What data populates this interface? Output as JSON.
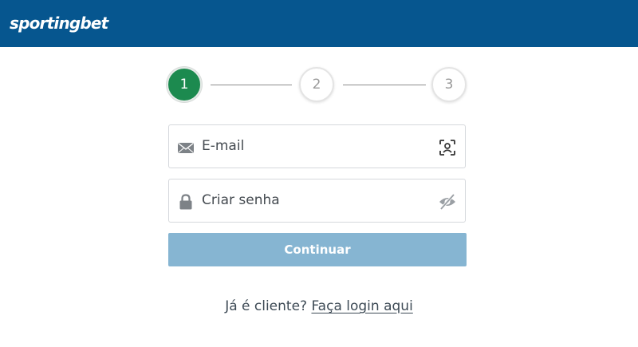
{
  "header": {
    "brand_left": "sporting",
    "brand_right": "bet",
    "background": "#06568f"
  },
  "stepper": {
    "steps": [
      "1",
      "2",
      "3"
    ],
    "active_step": 1,
    "active_color": "#1c8a4f"
  },
  "form": {
    "email": {
      "placeholder": "E-mail",
      "lead_icon": "mail-icon",
      "trail_icon": "face-scan-icon"
    },
    "password": {
      "placeholder": "Criar senha",
      "lead_icon": "lock-icon",
      "trail_icon": "eye-off-icon"
    },
    "continue_label": "Continuar",
    "continue_color": "#86b5d2"
  },
  "footer": {
    "prompt": "Já é cliente?",
    "login_link": "Faça login aqui"
  }
}
